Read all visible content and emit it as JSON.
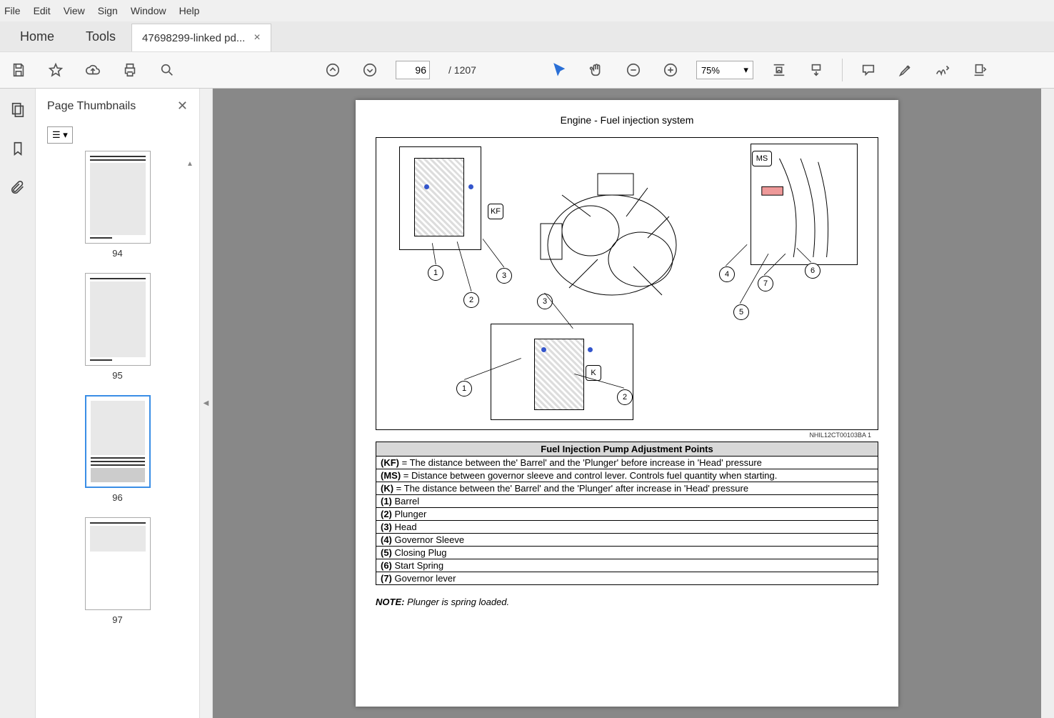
{
  "menu": [
    "File",
    "Edit",
    "View",
    "Sign",
    "Window",
    "Help"
  ],
  "tabs": {
    "home": "Home",
    "tools": "Tools",
    "doc": "47698299-linked pd..."
  },
  "toolbar": {
    "page": "96",
    "total": "1207",
    "zoom": "75%"
  },
  "thumbs": {
    "title": "Page Thumbnails",
    "items": [
      "94",
      "95",
      "96",
      "97"
    ],
    "selected": "96"
  },
  "doc": {
    "section": "Engine - Fuel injection system",
    "fig_caption": "NHIL12CT00103BA   1",
    "labels": {
      "kf": "KF",
      "ms": "MS",
      "k": "K"
    },
    "nums": [
      "1",
      "2",
      "3",
      "4",
      "5",
      "6",
      "7"
    ],
    "table_title": "Fuel Injection Pump Adjustment Points",
    "rows": [
      {
        "k": "(KF)",
        "v": " = The distance between the' Barrel' and the 'Plunger' before increase in 'Head' pressure"
      },
      {
        "k": "(MS)",
        "v": " = Distance between governor sleeve and control lever. Controls fuel quantity when starting."
      },
      {
        "k": "(K)",
        "v": " = The distance between the' Barrel' and the 'Plunger' after increase in 'Head' pressure"
      },
      {
        "k": "(1)",
        "v": " Barrel"
      },
      {
        "k": "(2)",
        "v": " Plunger"
      },
      {
        "k": "(3)",
        "v": " Head"
      },
      {
        "k": "(4)",
        "v": " Governor Sleeve"
      },
      {
        "k": "(5)",
        "v": " Closing Plug"
      },
      {
        "k": "(6)",
        "v": " Start Spring"
      },
      {
        "k": "(7)",
        "v": " Governor lever"
      }
    ],
    "note_label": "NOTE:",
    "note_text": " Plunger is spring loaded."
  }
}
